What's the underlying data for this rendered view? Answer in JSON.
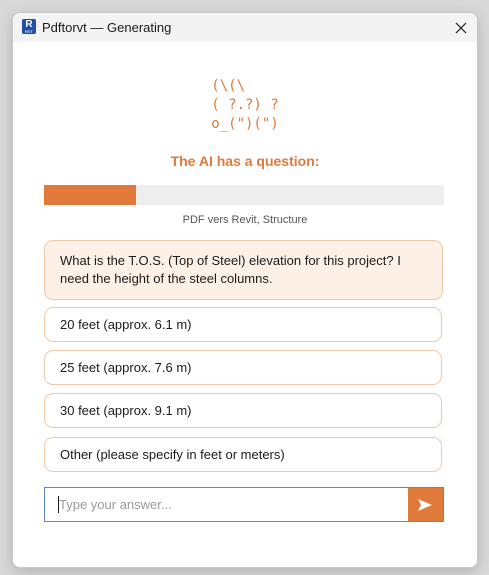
{
  "window": {
    "title": "Pdftorvt — Generating",
    "app_icon": "revit-app-icon",
    "app_icon_letter": "R",
    "app_icon_sub": "RVT"
  },
  "mascot": {
    "ascii_art": "(\\(\\\n( ?.?) ?\no_(\")(\")"
  },
  "heading": "The AI has a question:",
  "progress": {
    "fraction": 0.23,
    "label": "PDF vers Revit, Structure"
  },
  "question": "What is the T.O.S. (Top of Steel) elevation for this project? I need the height of the steel columns.",
  "options": [
    "20 feet (approx. 6.1 m)",
    "25 feet (approx. 7.6 m)",
    "30 feet (approx. 9.1 m)",
    "Other (please specify in feet or meters)"
  ],
  "answer": {
    "placeholder": "Type your answer...",
    "value": "",
    "send_icon": "send-arrow-icon"
  },
  "colors": {
    "accent": "#e07a3a",
    "question_bg": "#fdf0e6",
    "option_border": "#f0c8a8",
    "input_focus_border": "#5a88c8",
    "progress_track": "#eeeeee"
  }
}
